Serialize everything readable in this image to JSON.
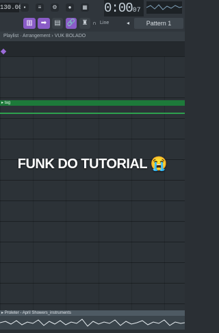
{
  "toolbar": {
    "tempo": "130.000",
    "clock_main": "0:00",
    "clock_sub": "07",
    "mode_label": "Line",
    "pattern": "Pattern 1"
  },
  "breadcrumb": "Playlist · Arrangement › VUK BOLADO",
  "tracks": {
    "tag_label": "tag"
  },
  "overlay": {
    "caption": "FUNK DO TUTORIAL 😭"
  },
  "clip": {
    "label": "Proleter - April Showers_instruments"
  },
  "colors": {
    "accent": "#8a5cc7",
    "tag_green": "#1d7a3a",
    "background": "#2a2f34"
  },
  "icons": [
    "piano-roll-icon",
    "arrow-right-icon",
    "step-icon",
    "link-icon",
    "stamp-icon",
    "magnet-icon"
  ]
}
